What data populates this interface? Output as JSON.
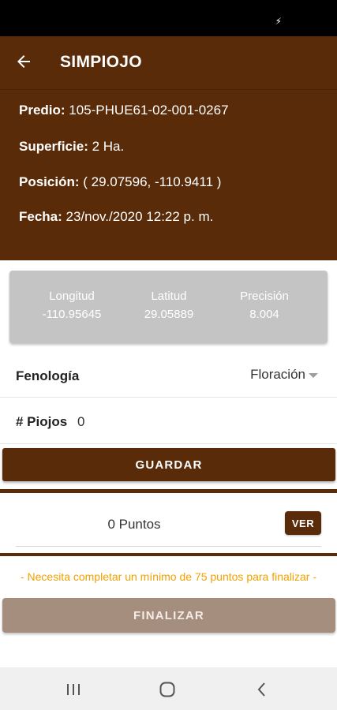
{
  "status_bar": {
    "battery_icon": "battery-charging-icon"
  },
  "header": {
    "title": "SIMPIOJO",
    "back_icon": "back-arrow-icon",
    "predio_label": "Predio:",
    "predio_value": " 105-PHUE61-02-001-0267",
    "superficie_label": "Superficie:",
    "superficie_value": " 2 Ha.",
    "posicion_label": "Posición:",
    "posicion_value": " ( 29.07596, -110.9411 )",
    "fecha_label": "Fecha:",
    "fecha_value": " 23/nov./2020 12:22 p. m."
  },
  "gps": {
    "longitud_label": "Longitud",
    "longitud_value": "-110.95645",
    "latitud_label": "Latitud",
    "latitud_value": "29.05889",
    "precision_label": "Precisión",
    "precision_value": "8.004"
  },
  "form": {
    "fenologia_label": "Fenología",
    "fenologia_value": "Floración",
    "piojos_label": "# Piojos",
    "piojos_value": "0",
    "guardar_label": "GUARDAR"
  },
  "points": {
    "text": "0 Puntos",
    "ver_label": "VER"
  },
  "warning": "- Necesita completar un mínimo de 75 puntos para finalizar -",
  "finalizar_label": "FINALIZAR",
  "colors": {
    "primary": "#5a2b08",
    "card": "#c4c4c4",
    "warning": "#f2a100",
    "disabled": "#a68e7e"
  }
}
